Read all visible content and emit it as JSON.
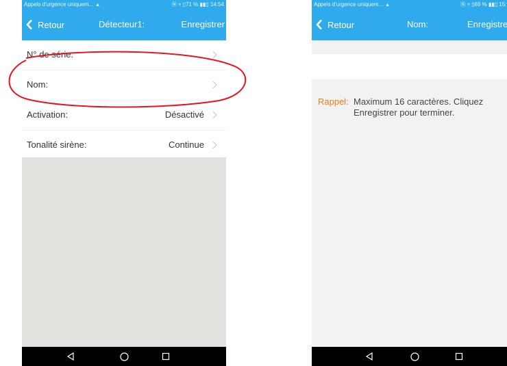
{
  "screens": [
    {
      "status": {
        "carrier": "Appels d'urgence uniquem...",
        "indicators": "Ⓝ ▿ ▯71 % ▮▮▯",
        "time": "14:54"
      },
      "nav": {
        "back_label": "Retour",
        "title": "Détecteur1:",
        "save_label": "Enregistrer"
      },
      "rows": [
        {
          "label": "N° de série:",
          "value": ""
        },
        {
          "label": "Nom:",
          "value": ""
        },
        {
          "label": "Activation:",
          "value": "Désactivé"
        },
        {
          "label": "Tonalité sirène:",
          "value": "Continue"
        }
      ],
      "annotation_color": "#e8141c"
    },
    {
      "status": {
        "carrier": "Appels d'urgence uniquem...",
        "indicators": "Ⓝ ▿ ▯69 % ▮▮▯",
        "time": "15:1"
      },
      "nav": {
        "back_label": "Retour",
        "title": "Nom:",
        "save_label": "Enregistre"
      },
      "name_input": {
        "value": ""
      },
      "hint": {
        "label": "Rappel:",
        "text": "Maximum 16 caractères. Cliquez Enregistrer pour terminer."
      }
    }
  ],
  "theme": {
    "accent": "#2eaaed",
    "hint_label_color": "#f07d1a",
    "content_gray": "#e2e1de"
  },
  "icons": [
    "chevron-left-icon",
    "chevron-right-icon",
    "cloud-icon",
    "back-triangle-icon",
    "home-circle-icon",
    "recents-square-icon"
  ]
}
